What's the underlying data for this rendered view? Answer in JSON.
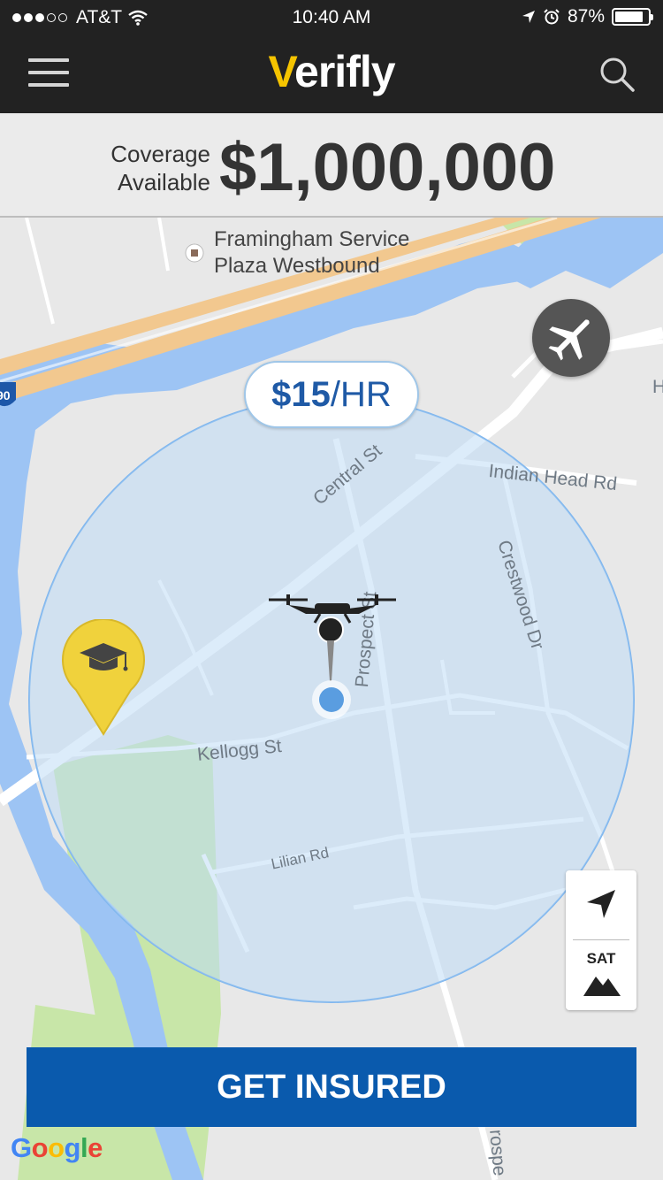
{
  "status_bar": {
    "carrier": "AT&T",
    "time": "10:40 AM",
    "battery_percent": "87%",
    "battery_level": 0.87,
    "signal_bars_filled": 3,
    "signal_bars_total": 5
  },
  "nav": {
    "logo_v": "V",
    "logo_rest": "erifly",
    "menu_icon": "hamburger-icon",
    "search_icon": "search-icon"
  },
  "coverage": {
    "label_line1": "Coverage",
    "label_line2": "Available",
    "amount": "$1,000,000"
  },
  "map": {
    "poi_name_line1": "Framingham Service",
    "poi_name_line2": "Plaza Westbound",
    "interstate_shield": "90",
    "rate_amount": "$15",
    "rate_unit": "/HR",
    "roads": {
      "central": "Central St",
      "indian_head": "Indian Head Rd",
      "crestwood": "Crestwood Dr",
      "prospect": "Prospect St",
      "kellogg": "Kellogg St",
      "lilian": "Lilian Rd",
      "prospect_bottom": "rospe",
      "edge_letter": "H"
    },
    "controls": {
      "locate_icon": "navigation-arrow-icon",
      "sat_label": "SAT",
      "terrain_icon": "mountain-icon"
    },
    "airport_icon": "airplane-icon",
    "school_marker_icon": "graduation-cap-icon",
    "drone_icon": "drone-icon",
    "google_logo": "Google"
  },
  "cta": {
    "label": "GET INSURED"
  },
  "colors": {
    "header_bg": "#222222",
    "logo_accent": "#f5c400",
    "cta_blue": "#0a5aad",
    "coverage_circle": "#9fcaf2",
    "water": "#9dc4f4",
    "highway": "#f2c88f",
    "park": "#c8e6a8",
    "school_pin": "#f0d23c"
  }
}
